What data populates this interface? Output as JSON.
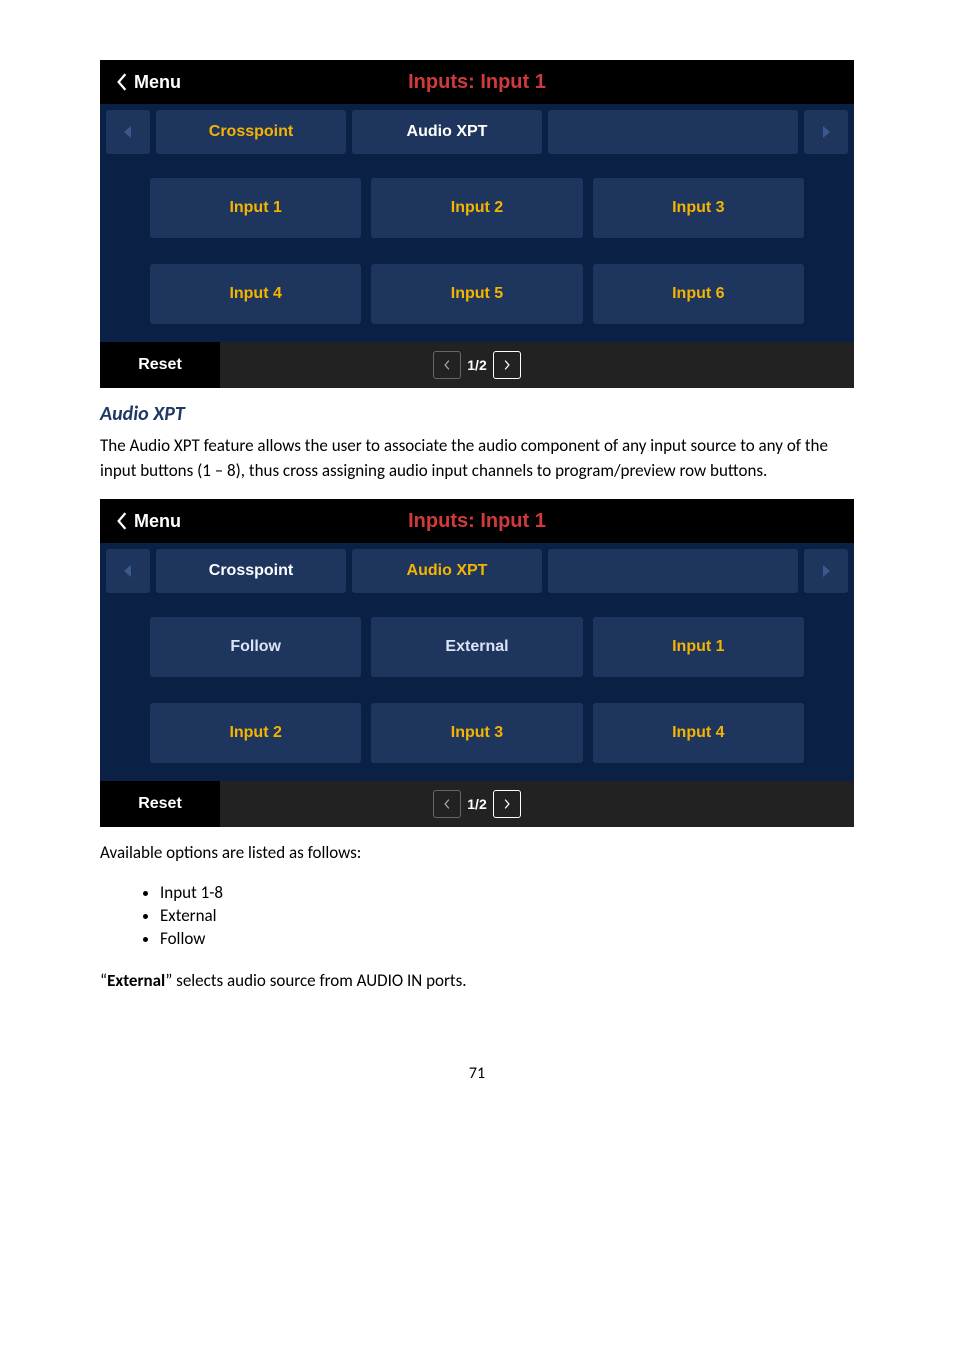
{
  "page_number": "71",
  "panel1": {
    "back_label": "Menu",
    "title": "Inputs: Input 1",
    "tabs": [
      "Crosspoint",
      "Audio XPT"
    ],
    "active_tab": 0,
    "buttons": [
      "Input 1",
      "Input 2",
      "Input 3",
      "Input 4",
      "Input 5",
      "Input 6"
    ],
    "accent": [],
    "reset": "Reset",
    "pager": "1/2"
  },
  "section_heading": "Audio XPT",
  "section_para": "The Audio XPT feature allows the user to associate the audio component of any input source to any of the input buttons (1 – 8), thus cross assigning audio input channels to program/preview row buttons.",
  "panel2": {
    "back_label": "Menu",
    "title": "Inputs: Input 1",
    "tabs": [
      "Crosspoint",
      "Audio XPT"
    ],
    "active_tab": 1,
    "buttons": [
      "Follow",
      "External",
      "Input 1",
      "Input 2",
      "Input 3",
      "Input 4"
    ],
    "accent": [
      2,
      3,
      4,
      5
    ],
    "accent_mixed": true,
    "reset": "Reset",
    "pager": "1/2"
  },
  "available_intro": "Available options are listed as follows:",
  "options": [
    "Input 1-8",
    "External",
    "Follow"
  ],
  "external_prefix": "“",
  "external_bold": "External",
  "external_suffix": "” selects audio source from AUDIO IN ports."
}
